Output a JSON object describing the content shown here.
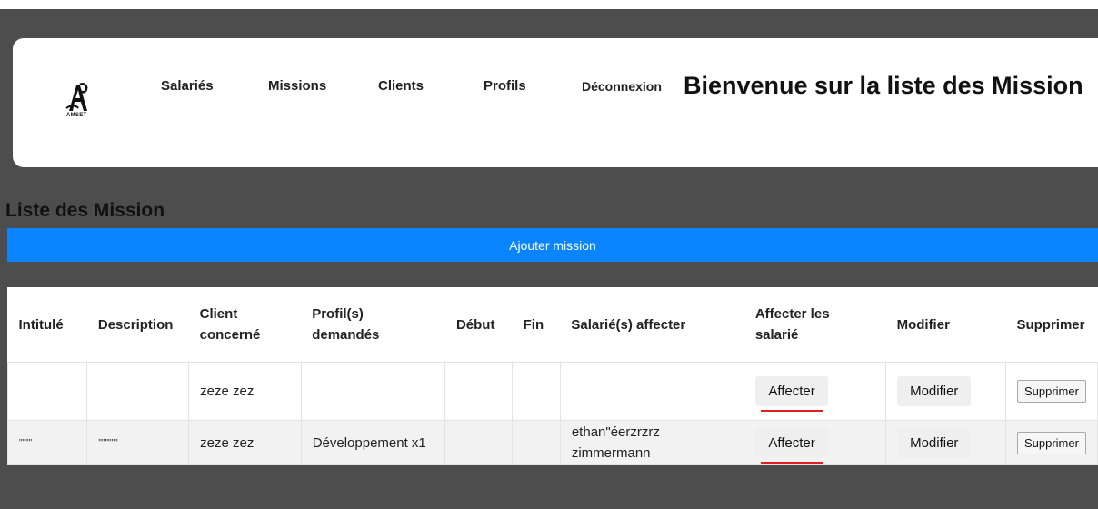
{
  "logo": {
    "text": "AMSET"
  },
  "nav": {
    "items": [
      {
        "label": "Salariés"
      },
      {
        "label": "Missions"
      },
      {
        "label": "Clients"
      },
      {
        "label": "Profils"
      },
      {
        "label": "Déconnexion"
      }
    ]
  },
  "header": {
    "title": "Bienvenue sur la liste des Mission"
  },
  "list": {
    "title": "Liste des Mission",
    "add_button": "Ajouter mission"
  },
  "table": {
    "headers": [
      "Intitulé",
      "Description",
      "Client concerné",
      "Profil(s) demandés",
      "Début",
      "Fin",
      "Salarié(s) affecter",
      "Affecter les salarié",
      "Modifier",
      "Supprimer"
    ],
    "rows": [
      {
        "intitule": "",
        "description": "",
        "client": "zeze zez",
        "profils": "",
        "debut": "",
        "fin": "",
        "salaries": "",
        "affecter": "Affecter",
        "modifier": "Modifier",
        "supprimer": "Supprimer"
      },
      {
        "intitule": "\"\"\"\"",
        "description": "\"\"\"\"\"\"",
        "client": "zeze zez",
        "profils": "Développement x1",
        "debut": "",
        "fin": "",
        "salaries": "ethan\"éerzrzrz zimmermann",
        "affecter": "Affecter",
        "modifier": "Modifier",
        "supprimer": "Supprimer"
      }
    ]
  },
  "colors": {
    "accent": "#0a84ff",
    "background": "#4d4d4d",
    "underline": "#e02020"
  }
}
